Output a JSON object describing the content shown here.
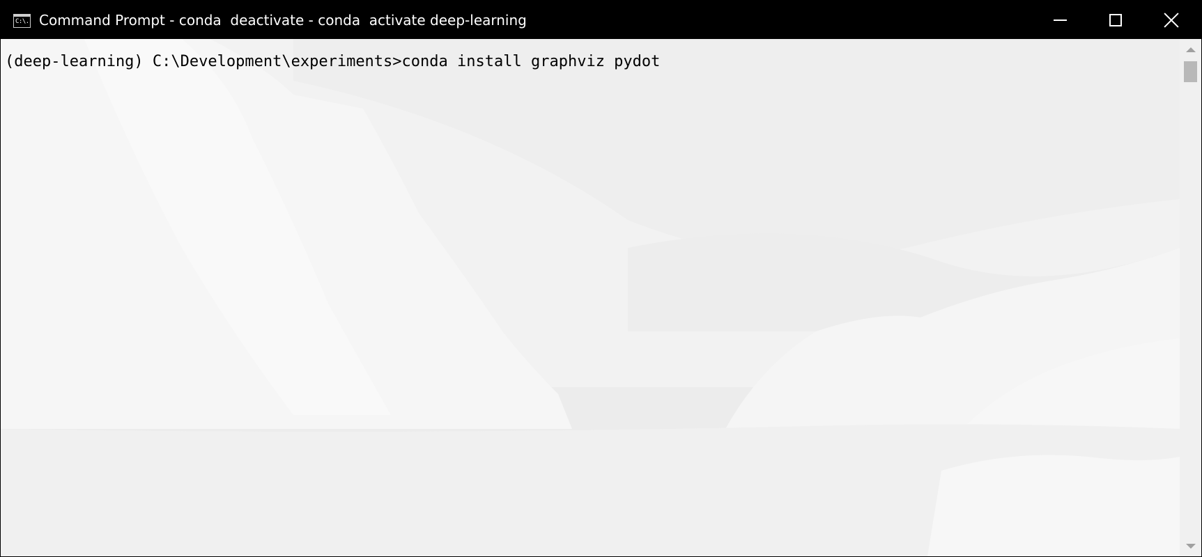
{
  "window": {
    "title": "Command Prompt - conda  deactivate - conda  activate deep-learning",
    "icon": "console-icon",
    "icon_text": "C:\\.",
    "controls": [
      "minimize-icon",
      "maximize-icon",
      "close-icon"
    ]
  },
  "console": {
    "prompt": "(deep-learning) C:\\Development\\experiments>",
    "command": "conda install graphviz pydot",
    "text_color": "#000000",
    "background_style": "light wallpaper of a coastal mountain fjord"
  },
  "scrollbar": {
    "up_icon": "chevron-up-icon",
    "down_icon": "chevron-down-icon"
  },
  "colors": {
    "titlebar": "#000000",
    "titlebar_text": "#ffffff",
    "console_bg": "#f1f1f1",
    "scrollbar_track": "#f0f0f0",
    "scrollbar_thumb": "#b8b8b8"
  }
}
